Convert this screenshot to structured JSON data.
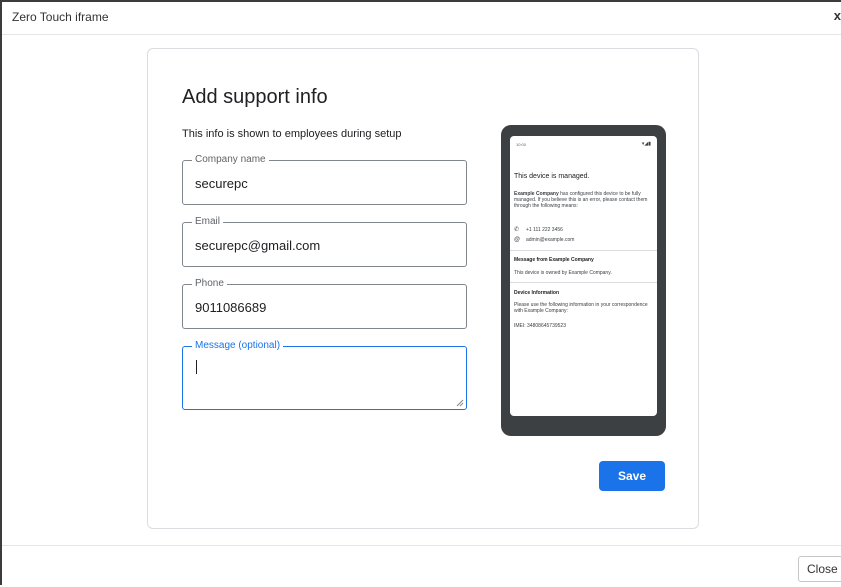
{
  "dialog": {
    "title": "Zero Touch iframe",
    "close_glyph": "x",
    "close_button_label": "Close"
  },
  "form": {
    "heading": "Add support info",
    "subtitle": "This info is shown to employees during setup",
    "fields": {
      "company": {
        "label": "Company name",
        "value": "securepc"
      },
      "email": {
        "label": "Email",
        "value": "securepc@gmail.com"
      },
      "phone": {
        "label": "Phone",
        "value": "9011086689"
      },
      "message": {
        "label": "Message (optional)",
        "value": ""
      }
    },
    "save_label": "Save"
  },
  "preview": {
    "time": "10:00",
    "status_icons": "▾◢▮",
    "title": "This device is managed.",
    "company_bold": "Example Company",
    "body_rest": " has configured this device to be fully managed. If you believe this is an error, please contact them through the following means:",
    "phone": "+1 111 222 3456",
    "email": "admin@example.com",
    "message_heading": "Message from Example Company",
    "message_text": "This device is owned by Example Company.",
    "device_heading": "Device Information",
    "device_text": "Please use the following information in your correspondence with Example Company:",
    "imei": "IMEI: 34808645739523",
    "phone_icon": "phone-icon",
    "email_icon": "at-icon"
  },
  "colors": {
    "accent": "#1a73e8",
    "phone_frame": "#3c4043"
  }
}
